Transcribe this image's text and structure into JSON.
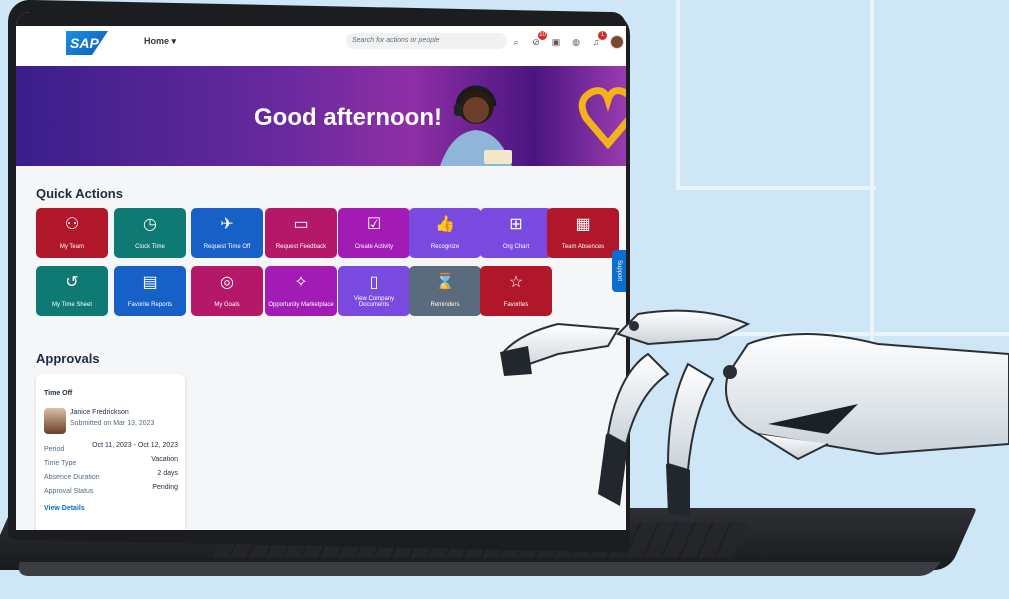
{
  "header": {
    "logo": "SAP",
    "home_menu": "Home ▾",
    "search_placeholder": "Search for actions or people",
    "notification_badges": [
      "10",
      "1"
    ]
  },
  "banner": {
    "greeting": "Good afternoon!"
  },
  "quick_actions": {
    "title": "Quick Actions",
    "tiles": [
      {
        "label": "My Team",
        "color": "#b0172a",
        "icon": "org-people-icon"
      },
      {
        "label": "Clock Time",
        "color": "#0f7a73",
        "icon": "clock-add-icon"
      },
      {
        "label": "Request Time Off",
        "color": "#1760c8",
        "icon": "airplane-icon"
      },
      {
        "label": "Request Feedback",
        "color": "#b51868",
        "icon": "feedback-icon"
      },
      {
        "label": "Create Activity",
        "color": "#a31bb5",
        "icon": "clipboard-check-icon"
      },
      {
        "label": "Recognize",
        "color": "#7a4ae0",
        "icon": "thumbs-up-icon"
      },
      {
        "label": "Org Chart",
        "color": "#7a4ae0",
        "icon": "org-chart-icon"
      },
      {
        "label": "Team Absences",
        "color": "#b0172a",
        "icon": "calendar-icon"
      },
      {
        "label": "My Time Sheet",
        "color": "#0f7a73",
        "icon": "history-icon"
      },
      {
        "label": "Favorite Reports",
        "color": "#1760c8",
        "icon": "reports-icon"
      },
      {
        "label": "My Goals",
        "color": "#b51868",
        "icon": "target-icon"
      },
      {
        "label": "Opportunity Marketplace",
        "color": "#a31bb5",
        "icon": "chart-sparkle-icon"
      },
      {
        "label": "View Company Documents",
        "color": "#7a4ae0",
        "icon": "document-icon"
      },
      {
        "label": "Reminders",
        "color": "#5a6b7d",
        "icon": "reminder-icon"
      },
      {
        "label": "Favorites",
        "color": "#b0172a",
        "icon": "star-list-icon"
      }
    ]
  },
  "approvals": {
    "title": "Approvals",
    "card": {
      "type": "Time Off",
      "name": "Janice Fredrickson",
      "submitted": "Submitted on Mar 13, 2023",
      "rows": [
        {
          "label": "Period",
          "value": "Oct 11, 2023 - Oct 12, 2023"
        },
        {
          "label": "Time Type",
          "value": "Vacation"
        },
        {
          "label": "Absence Duration",
          "value": "2 days"
        },
        {
          "label": "Approval Status",
          "value": "Pending"
        }
      ],
      "link": "View Details"
    }
  },
  "support": "Support"
}
